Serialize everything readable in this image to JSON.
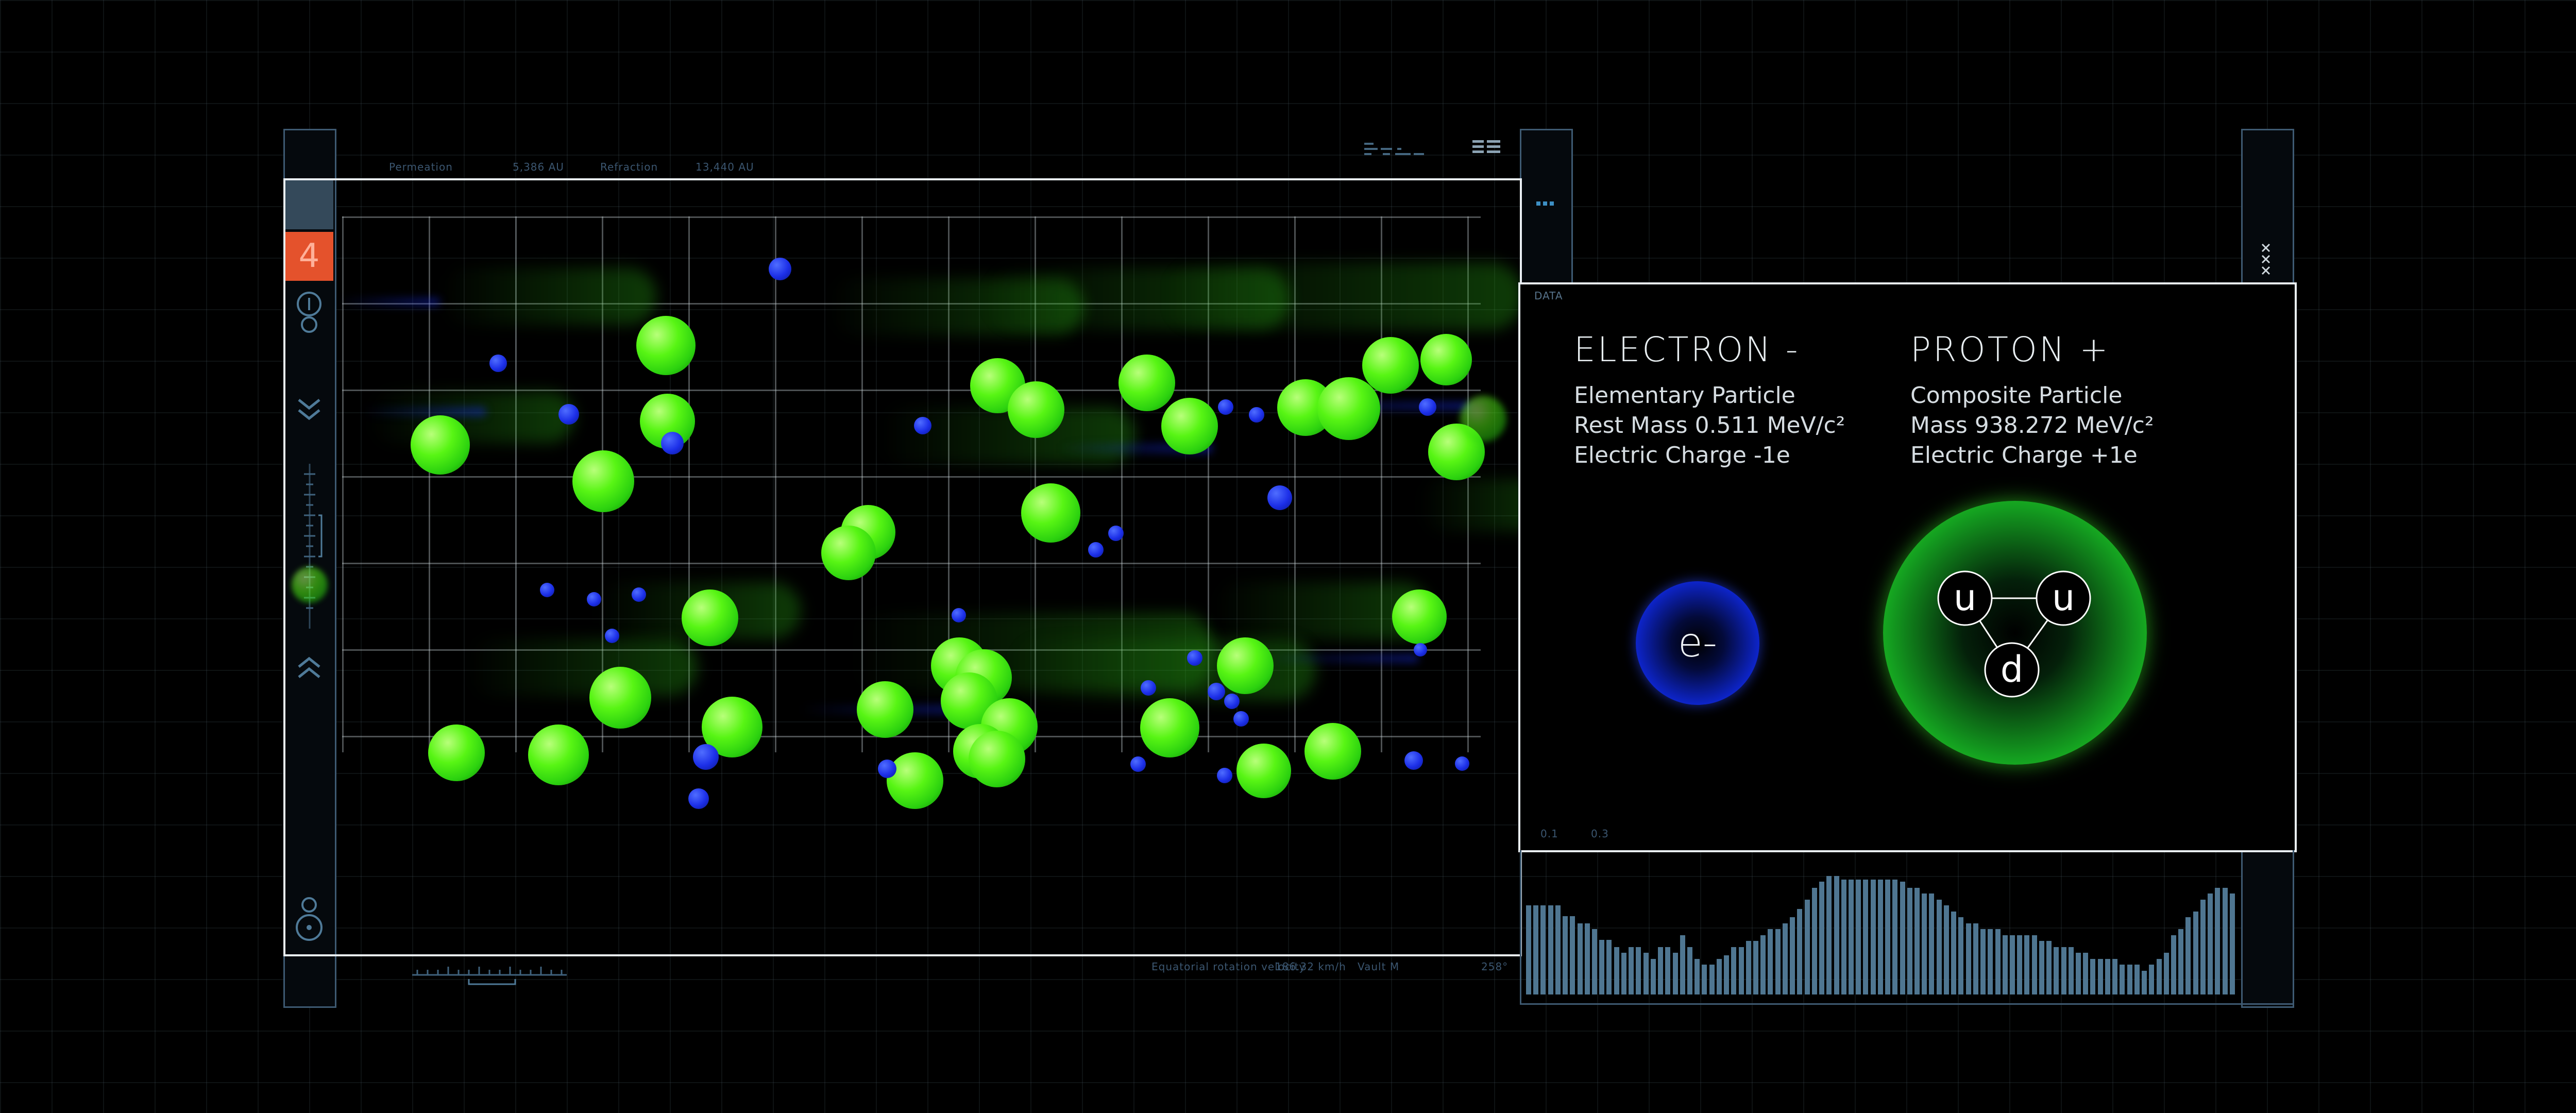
{
  "left_panel": {
    "rail_number": "4",
    "header_labels": [
      "Permeation",
      "5,386 AU",
      "Refraction",
      "13,440 AU"
    ],
    "footer_labels": [
      "Equatorial rotation velocity",
      "186.32 km/h",
      "Vault M",
      "258°"
    ]
  },
  "data_panel": {
    "label": "DATA",
    "footer_labels": [
      "0.1",
      "0.3"
    ],
    "electron": {
      "title": "ELECTRON -",
      "line1": "Elementary Particle",
      "line2": "Rest Mass 0.511 MeV/c²",
      "line3": "Electric Charge -1e",
      "symbol": "e-"
    },
    "proton": {
      "title": "PROTON +",
      "line1": "Composite Particle",
      "line2": "Mass 938.272 MeV/c²",
      "line3": "Electric Charge +1e",
      "quarks": [
        "u",
        "u",
        "d"
      ]
    }
  },
  "histogram": {
    "values": [
      0.75,
      0.75,
      0.75,
      0.75,
      0.75,
      0.66,
      0.66,
      0.6,
      0.6,
      0.55,
      0.46,
      0.46,
      0.4,
      0.35,
      0.4,
      0.4,
      0.35,
      0.3,
      0.4,
      0.4,
      0.35,
      0.5,
      0.4,
      0.3,
      0.25,
      0.25,
      0.3,
      0.33,
      0.4,
      0.4,
      0.45,
      0.45,
      0.5,
      0.55,
      0.55,
      0.6,
      0.65,
      0.72,
      0.8,
      0.9,
      0.95,
      1.0,
      1.0,
      0.97,
      0.97,
      0.97,
      0.97,
      0.97,
      0.97,
      0.97,
      0.97,
      0.95,
      0.9,
      0.9,
      0.85,
      0.85,
      0.8,
      0.75,
      0.7,
      0.65,
      0.6,
      0.6,
      0.55,
      0.55,
      0.55,
      0.5,
      0.5,
      0.5,
      0.5,
      0.5,
      0.45,
      0.45,
      0.4,
      0.4,
      0.4,
      0.35,
      0.35,
      0.3,
      0.3,
      0.3,
      0.3,
      0.25,
      0.25,
      0.25,
      0.2,
      0.25,
      0.3,
      0.35,
      0.5,
      0.55,
      0.65,
      0.7,
      0.8,
      0.85,
      0.9,
      0.9,
      0.85
    ]
  },
  "colors": {
    "accent_orange": "#e4522c",
    "frame": "#e9eef2",
    "rail": "#3e5a72",
    "electron": "#1c2fe8",
    "proton": "#38f01c"
  },
  "icons": [
    "circle-stack-icon",
    "chevron-double-down-icon",
    "chevron-double-up-icon",
    "ruler-icon",
    "target-icon",
    "close-stack-icon",
    "dots-icon",
    "barcode-icon"
  ]
}
